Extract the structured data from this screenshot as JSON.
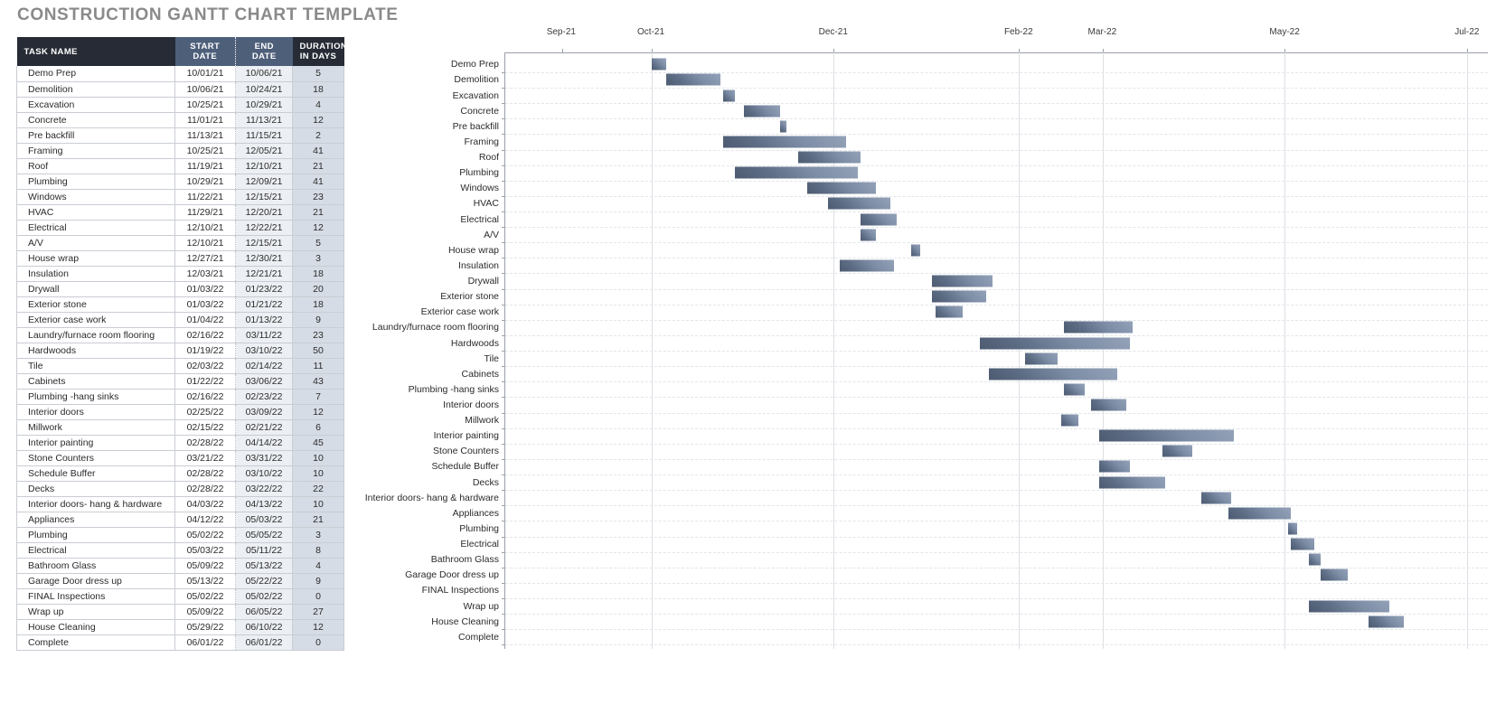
{
  "title": "CONSTRUCTION GANTT CHART TEMPLATE",
  "table": {
    "headers": {
      "task": "TASK NAME",
      "start": "START DATE",
      "end": "END DATE",
      "duration": "DURATION IN DAYS"
    }
  },
  "chart_data": {
    "type": "bar",
    "title": "CONSTRUCTION GANTT CHART TEMPLATE",
    "xlabel": "",
    "ylabel": "",
    "grid": true,
    "legend": null,
    "orientation": "horizontal",
    "axis_ticks": [
      "Sep-21",
      "Oct-21",
      "Dec-21",
      "Feb-22",
      "Mar-22",
      "May-22",
      "Jul-22"
    ],
    "axis_tick_dates": [
      "2021-09-01",
      "2021-10-01",
      "2021-12-01",
      "2022-02-01",
      "2022-03-01",
      "2022-05-01",
      "2022-07-01"
    ],
    "xlim": [
      "2021-08-13",
      "2022-07-08"
    ],
    "bar_color": "#6e7f99",
    "categories": [
      "Demo Prep",
      "Demolition",
      "Excavation",
      "Concrete",
      "Pre backfill",
      "Framing",
      "Roof",
      "Plumbing",
      "Windows",
      "HVAC",
      "Electrical",
      "A/V",
      "House wrap",
      "Insulation",
      "Drywall",
      "Exterior stone",
      "Exterior case work",
      "Laundry/furnace room flooring",
      "Hardwoods",
      "Tile",
      "Cabinets",
      "Plumbing -hang sinks",
      "Interior doors",
      "Millwork",
      "Interior painting",
      "Stone Counters",
      "Schedule Buffer",
      "Decks",
      "Interior doors- hang & hardware",
      "Appliances",
      "Plumbing",
      "Electrical",
      "Bathroom Glass",
      "Garage Door dress up",
      "FINAL Inspections",
      "Wrap up",
      "House Cleaning",
      "Complete"
    ],
    "rows": [
      {
        "task": "Demo Prep",
        "start": "10/01/21",
        "end": "10/06/21",
        "duration": 5,
        "start_iso": "2021-10-01",
        "end_iso": "2021-10-06"
      },
      {
        "task": "Demolition",
        "start": "10/06/21",
        "end": "10/24/21",
        "duration": 18,
        "start_iso": "2021-10-06",
        "end_iso": "2021-10-24"
      },
      {
        "task": "Excavation",
        "start": "10/25/21",
        "end": "10/29/21",
        "duration": 4,
        "start_iso": "2021-10-25",
        "end_iso": "2021-10-29"
      },
      {
        "task": "Concrete",
        "start": "11/01/21",
        "end": "11/13/21",
        "duration": 12,
        "start_iso": "2021-11-01",
        "end_iso": "2021-11-13"
      },
      {
        "task": "Pre backfill",
        "start": "11/13/21",
        "end": "11/15/21",
        "duration": 2,
        "start_iso": "2021-11-13",
        "end_iso": "2021-11-15"
      },
      {
        "task": "Framing",
        "start": "10/25/21",
        "end": "12/05/21",
        "duration": 41,
        "start_iso": "2021-10-25",
        "end_iso": "2021-12-05"
      },
      {
        "task": "Roof",
        "start": "11/19/21",
        "end": "12/10/21",
        "duration": 21,
        "start_iso": "2021-11-19",
        "end_iso": "2021-12-10"
      },
      {
        "task": "Plumbing",
        "start": "10/29/21",
        "end": "12/09/21",
        "duration": 41,
        "start_iso": "2021-10-29",
        "end_iso": "2021-12-09"
      },
      {
        "task": "Windows",
        "start": "11/22/21",
        "end": "12/15/21",
        "duration": 23,
        "start_iso": "2021-11-22",
        "end_iso": "2021-12-15"
      },
      {
        "task": "HVAC",
        "start": "11/29/21",
        "end": "12/20/21",
        "duration": 21,
        "start_iso": "2021-11-29",
        "end_iso": "2021-12-20"
      },
      {
        "task": "Electrical",
        "start": "12/10/21",
        "end": "12/22/21",
        "duration": 12,
        "start_iso": "2021-12-10",
        "end_iso": "2021-12-22"
      },
      {
        "task": "A/V",
        "start": "12/10/21",
        "end": "12/15/21",
        "duration": 5,
        "start_iso": "2021-12-10",
        "end_iso": "2021-12-15"
      },
      {
        "task": "House wrap",
        "start": "12/27/21",
        "end": "12/30/21",
        "duration": 3,
        "start_iso": "2021-12-27",
        "end_iso": "2021-12-30"
      },
      {
        "task": "Insulation",
        "start": "12/03/21",
        "end": "12/21/21",
        "duration": 18,
        "start_iso": "2021-12-03",
        "end_iso": "2021-12-21"
      },
      {
        "task": "Drywall",
        "start": "01/03/22",
        "end": "01/23/22",
        "duration": 20,
        "start_iso": "2022-01-03",
        "end_iso": "2022-01-23"
      },
      {
        "task": "Exterior stone",
        "start": "01/03/22",
        "end": "01/21/22",
        "duration": 18,
        "start_iso": "2022-01-03",
        "end_iso": "2022-01-21"
      },
      {
        "task": "Exterior case work",
        "start": "01/04/22",
        "end": "01/13/22",
        "duration": 9,
        "start_iso": "2022-01-04",
        "end_iso": "2022-01-13"
      },
      {
        "task": "Laundry/furnace room flooring",
        "start": "02/16/22",
        "end": "03/11/22",
        "duration": 23,
        "start_iso": "2022-02-16",
        "end_iso": "2022-03-11"
      },
      {
        "task": "Hardwoods",
        "start": "01/19/22",
        "end": "03/10/22",
        "duration": 50,
        "start_iso": "2022-01-19",
        "end_iso": "2022-03-10"
      },
      {
        "task": "Tile",
        "start": "02/03/22",
        "end": "02/14/22",
        "duration": 11,
        "start_iso": "2022-02-03",
        "end_iso": "2022-02-14"
      },
      {
        "task": "Cabinets",
        "start": "01/22/22",
        "end": "03/06/22",
        "duration": 43,
        "start_iso": "2022-01-22",
        "end_iso": "2022-03-06"
      },
      {
        "task": "Plumbing -hang sinks",
        "start": "02/16/22",
        "end": "02/23/22",
        "duration": 7,
        "start_iso": "2022-02-16",
        "end_iso": "2022-02-23"
      },
      {
        "task": "Interior doors",
        "start": "02/25/22",
        "end": "03/09/22",
        "duration": 12,
        "start_iso": "2022-02-25",
        "end_iso": "2022-03-09"
      },
      {
        "task": "Millwork",
        "start": "02/15/22",
        "end": "02/21/22",
        "duration": 6,
        "start_iso": "2022-02-15",
        "end_iso": "2022-02-21"
      },
      {
        "task": "Interior painting",
        "start": "02/28/22",
        "end": "04/14/22",
        "duration": 45,
        "start_iso": "2022-02-28",
        "end_iso": "2022-04-14"
      },
      {
        "task": "Stone Counters",
        "start": "03/21/22",
        "end": "03/31/22",
        "duration": 10,
        "start_iso": "2022-03-21",
        "end_iso": "2022-03-31"
      },
      {
        "task": "Schedule Buffer",
        "start": "02/28/22",
        "end": "03/10/22",
        "duration": 10,
        "start_iso": "2022-02-28",
        "end_iso": "2022-03-10"
      },
      {
        "task": "Decks",
        "start": "02/28/22",
        "end": "03/22/22",
        "duration": 22,
        "start_iso": "2022-02-28",
        "end_iso": "2022-03-22"
      },
      {
        "task": "Interior doors- hang & hardware",
        "start": "04/03/22",
        "end": "04/13/22",
        "duration": 10,
        "start_iso": "2022-04-03",
        "end_iso": "2022-04-13"
      },
      {
        "task": "Appliances",
        "start": "04/12/22",
        "end": "05/03/22",
        "duration": 21,
        "start_iso": "2022-04-12",
        "end_iso": "2022-05-03"
      },
      {
        "task": "Plumbing",
        "start": "05/02/22",
        "end": "05/05/22",
        "duration": 3,
        "start_iso": "2022-05-02",
        "end_iso": "2022-05-05"
      },
      {
        "task": "Electrical",
        "start": "05/03/22",
        "end": "05/11/22",
        "duration": 8,
        "start_iso": "2022-05-03",
        "end_iso": "2022-05-11"
      },
      {
        "task": "Bathroom Glass",
        "start": "05/09/22",
        "end": "05/13/22",
        "duration": 4,
        "start_iso": "2022-05-09",
        "end_iso": "2022-05-13"
      },
      {
        "task": "Garage Door dress up",
        "start": "05/13/22",
        "end": "05/22/22",
        "duration": 9,
        "start_iso": "2022-05-13",
        "end_iso": "2022-05-22"
      },
      {
        "task": "FINAL Inspections",
        "start": "05/02/22",
        "end": "05/02/22",
        "duration": 0,
        "start_iso": "2022-05-02",
        "end_iso": "2022-05-02"
      },
      {
        "task": "Wrap up",
        "start": "05/09/22",
        "end": "06/05/22",
        "duration": 27,
        "start_iso": "2022-05-09",
        "end_iso": "2022-06-05"
      },
      {
        "task": "House Cleaning",
        "start": "05/29/22",
        "end": "06/10/22",
        "duration": 12,
        "start_iso": "2022-05-29",
        "end_iso": "2022-06-10"
      },
      {
        "task": "Complete",
        "start": "06/01/22",
        "end": "06/01/22",
        "duration": 0,
        "start_iso": "2022-06-01",
        "end_iso": "2022-06-01"
      }
    ]
  }
}
